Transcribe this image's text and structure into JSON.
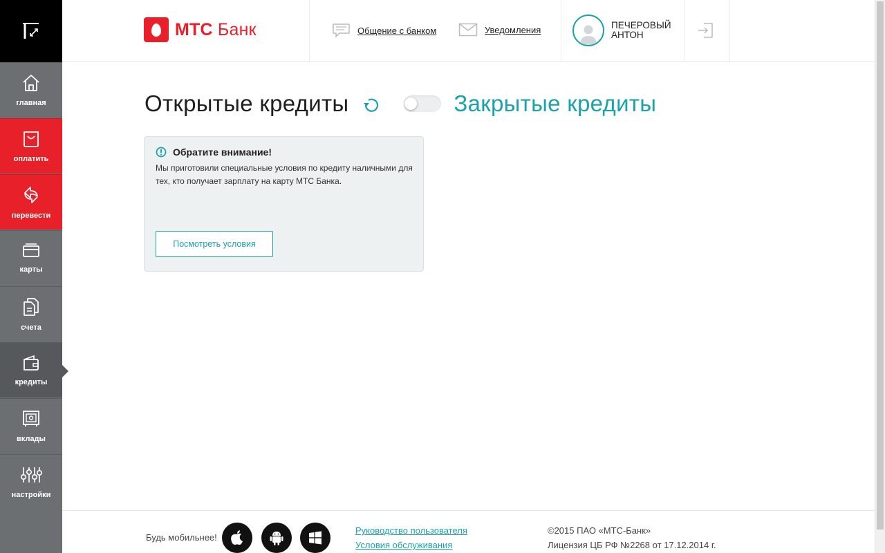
{
  "sidebar": {
    "items": [
      {
        "label": "главная",
        "icon": "home-icon"
      },
      {
        "label": "оплатить",
        "icon": "shopping-bag-icon"
      },
      {
        "label": "перевести",
        "icon": "transfer-arrows-icon"
      },
      {
        "label": "карты",
        "icon": "card-icon"
      },
      {
        "label": "счета",
        "icon": "documents-icon"
      },
      {
        "label": "кредиты",
        "icon": "wallet-icon"
      },
      {
        "label": "вклады",
        "icon": "safe-icon"
      },
      {
        "label": "настройки",
        "icon": "sliders-icon"
      }
    ],
    "active": "кредиты"
  },
  "header": {
    "brand_mts": "МТС",
    "brand_bank": "Банк",
    "chat_label": "Общение с банком",
    "notifications_label": "Уведомления",
    "user_name_line1": "ПЕЧЕРОВЫЙ",
    "user_name_line2": "АНТОН"
  },
  "main": {
    "title_open": "Открытые кредиты",
    "title_closed": "Закрытые кредиты",
    "toggle_state": "off",
    "notice": {
      "title": "Обратите внимание!",
      "text": "Мы приготовили специальные условия по кредиту наличными для тех, кто получает зарплату на карту МТС Банка.",
      "button_label": "Посмотреть условия"
    }
  },
  "footer": {
    "mobile_label": "Будь мобильнее!",
    "stores": [
      "apple-icon",
      "android-icon",
      "windows-icon"
    ],
    "link_guide": "Руководство пользователя",
    "link_terms": "Условия обслуживания",
    "copyright": "©2015 ПАО «МТС-Банк»",
    "license": "Лицензия ЦБ РФ №2268 от 17.12.2014 г."
  },
  "colors": {
    "accent": "#1aa3a8",
    "brand_red": "#e8202a",
    "sidebar_bg": "#6b6f72",
    "sidebar_active": "#55595c"
  }
}
